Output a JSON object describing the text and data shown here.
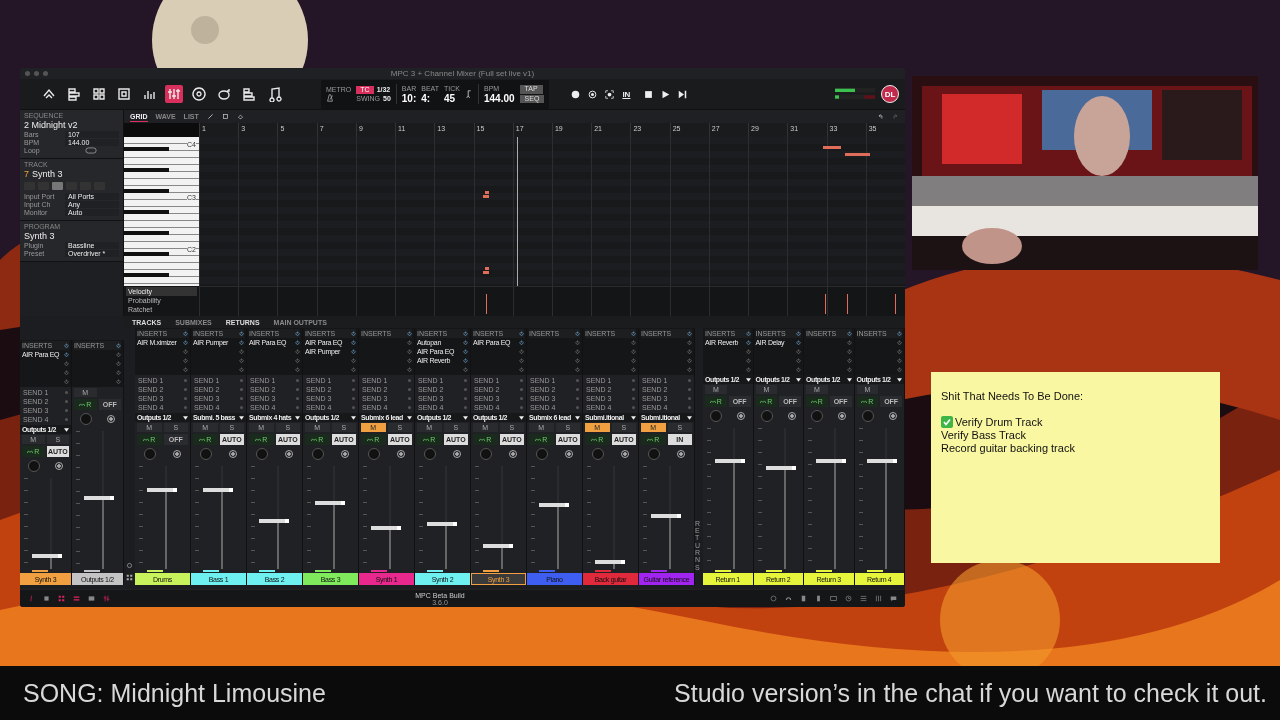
{
  "app": {
    "title": "MPC 3 + Channel Mixer (Full set live v1)",
    "view_buttons": [
      {
        "selected": false
      },
      {
        "selected": false
      },
      {
        "selected": false
      },
      {
        "selected": false
      },
      {
        "selected": false
      },
      {
        "selected": true
      },
      {
        "selected": false
      },
      {
        "selected": false
      },
      {
        "selected": false
      },
      {
        "selected": false
      }
    ],
    "transport": {
      "metro": "METRO",
      "tc": "TC",
      "tc_value": "1/32",
      "swing_label": "SWING",
      "swing": "50",
      "bar_label": "BAR",
      "bar": "10:",
      "beat_label": "BEAT",
      "beat": "4:",
      "tick_label": "TICK",
      "tick": "45",
      "bpm_label": "BPM",
      "bpm": "144.00",
      "tap": "TAP",
      "seq": "SEQ",
      "in": "IN",
      "user": "DL"
    },
    "sequence": {
      "header": "SEQUENCE",
      "name": "2 Midnight v2",
      "fields": [
        {
          "label": "Bars",
          "value": "107"
        },
        {
          "label": "BPM",
          "value": "144.00"
        }
      ],
      "loop": "Loop"
    },
    "track": {
      "header": "TRACK",
      "number": "7",
      "name": "Synth 3",
      "modes": [
        {
          "selected": false
        },
        {
          "selected": false
        },
        {
          "selected": true
        },
        {
          "selected": false
        },
        {
          "selected": false
        },
        {
          "selected": false
        }
      ],
      "fields": [
        {
          "label": "Input Port",
          "value": "All Ports"
        },
        {
          "label": "Input Ch",
          "value": "Any"
        },
        {
          "label": "Monitor",
          "value": "Auto"
        }
      ]
    },
    "program": {
      "header": "PROGRAM",
      "name": "Synth 3",
      "fields": [
        {
          "label": "Plugin",
          "value": "Bassline"
        },
        {
          "label": "Preset",
          "value": "Overdriver *"
        }
      ]
    },
    "editor_tabs": [
      {
        "label": "GRID",
        "selected": true
      },
      {
        "label": "WAVE",
        "selected": false
      },
      {
        "label": "LIST",
        "selected": false
      }
    ],
    "ruler": [
      "1",
      "3",
      "5",
      "7",
      "9",
      "11",
      "13",
      "15",
      "17",
      "19",
      "21",
      "23",
      "25",
      "27",
      "29",
      "31",
      "33",
      "35"
    ],
    "keys": [
      "C4",
      "C3",
      "C2"
    ],
    "lanes": [
      {
        "label": "Velocity",
        "selected": true
      },
      {
        "label": "Probability",
        "selected": false
      },
      {
        "label": "Ratchet",
        "selected": false
      }
    ],
    "mixer_tabs": [
      {
        "label": "TRACKS",
        "on": true
      },
      {
        "label": "SUBMIXES",
        "on": false
      },
      {
        "label": "RETURNS",
        "on": true
      },
      {
        "label": "MAIN OUTPUTS",
        "on": false
      }
    ],
    "returns_label": "RETURNS",
    "left_strips": [
      {
        "inserts_label": "INSERTS",
        "inserts": [
          "AIR Para EQ"
        ],
        "sends": [
          "SEND 1",
          "SEND 2",
          "SEND 3",
          "SEND 4"
        ],
        "output": "Outputs 1/2",
        "mute": "M",
        "muted": false,
        "solo": "S",
        "read": "R",
        "mode": "AUTO",
        "mode_on": true,
        "level": 0.12,
        "name": "Synth 3",
        "color": "#f0a040",
        "selected": false
      },
      {
        "inserts_label": "INSERTS",
        "mute": "M",
        "muted": false,
        "read": "R",
        "mode": "OFF",
        "mode_on": false,
        "level": 0.5,
        "name": "Outputs 1/2",
        "color": "#c4c4c4",
        "selected": false
      }
    ],
    "channels": [
      {
        "inserts_label": "INSERTS",
        "inserts": [
          "AIR M.ximizer"
        ],
        "sends": [
          "SEND 1",
          "SEND 2",
          "SEND 3",
          "SEND 4"
        ],
        "output": "Outputs 1/2",
        "mute": "M",
        "muted": false,
        "solo": "S",
        "read": "R",
        "mode": "OFF",
        "mode_on": false,
        "level": 0.75,
        "name": "Drums",
        "color": "#c8f25c",
        "selected": false
      },
      {
        "inserts_label": "INSERTS",
        "inserts": [
          "AIR Pumper"
        ],
        "sends": [
          "SEND 1",
          "SEND 2",
          "SEND 3",
          "SEND 4"
        ],
        "output": "Submi. 5 bass",
        "mute": "M",
        "muted": false,
        "solo": "S",
        "read": "R",
        "mode": "AUTO",
        "mode_on": true,
        "level": 0.75,
        "name": "Bass 1",
        "color": "#6ff0f0",
        "selected": false
      },
      {
        "inserts_label": "INSERTS",
        "inserts": [
          "AIR Para EQ"
        ],
        "sends": [
          "SEND 1",
          "SEND 2",
          "SEND 3",
          "SEND 4"
        ],
        "output": "Submix 4 hats",
        "mute": "M",
        "muted": false,
        "solo": "S",
        "read": "R",
        "mode": "AUTO",
        "mode_on": true,
        "level": 0.45,
        "name": "Bass 2",
        "color": "#6ff0f0",
        "selected": false
      },
      {
        "inserts_label": "INSERTS",
        "inserts": [
          "AIR Para EQ",
          "AIR Pumper"
        ],
        "sends": [
          "SEND 1",
          "SEND 2",
          "SEND 3",
          "SEND 4"
        ],
        "output": "Outputs 1/2",
        "mute": "M",
        "muted": false,
        "solo": "S",
        "read": "R",
        "mode": "AUTO",
        "mode_on": true,
        "level": 0.62,
        "name": "Bass 3",
        "color": "#7eea5c",
        "selected": false
      },
      {
        "inserts_label": "INSERTS",
        "sends": [
          "SEND 1",
          "SEND 2",
          "SEND 3",
          "SEND 4"
        ],
        "output": "Submix 6 lead",
        "mute": "M",
        "muted": true,
        "solo": "S",
        "read": "R",
        "mode": "AUTO",
        "mode_on": true,
        "level": 0.38,
        "name": "Synth 1",
        "color": "#e8288c",
        "selected": false
      },
      {
        "inserts_label": "INSERTS",
        "inserts": [
          "Autopan",
          "AIR Para EQ",
          "AIR Reverb"
        ],
        "sends": [
          "SEND 1",
          "SEND 2",
          "SEND 3",
          "SEND 4"
        ],
        "output": "Outputs 1/2",
        "mute": "M",
        "muted": false,
        "solo": "S",
        "read": "R",
        "mode": "AUTO",
        "mode_on": true,
        "level": 0.42,
        "name": "Synth 2",
        "color": "#6ff0f0",
        "selected": false
      },
      {
        "inserts_label": "INSERTS",
        "inserts": [
          "AIR Para EQ"
        ],
        "sends": [
          "SEND 1",
          "SEND 2",
          "SEND 3",
          "SEND 4"
        ],
        "output": "Outputs 1/2",
        "mute": "M",
        "muted": false,
        "solo": "S",
        "read": "R",
        "mode": "AUTO",
        "mode_on": true,
        "level": 0.2,
        "name": "Synth 3",
        "color": "#f0a040",
        "selected": true
      },
      {
        "inserts_label": "INSERTS",
        "sends": [
          "SEND 1",
          "SEND 2",
          "SEND 3",
          "SEND 4"
        ],
        "output": "Submix 6 lead",
        "mute": "M",
        "muted": false,
        "solo": "S",
        "read": "R",
        "mode": "AUTO",
        "mode_on": true,
        "level": 0.6,
        "name": "Piano",
        "color": "#3d5ef0",
        "selected": false
      },
      {
        "inserts_label": "INSERTS",
        "sends": [
          "SEND 1",
          "SEND 2",
          "SEND 3",
          "SEND 4"
        ],
        "output": "Submi.itional",
        "mute": "M",
        "muted": true,
        "solo": "S",
        "read": "R",
        "mode": "AUTO",
        "mode_on": true,
        "level": 0.05,
        "name": "Back guitar",
        "color": "#e02a3c",
        "selected": false
      },
      {
        "inserts_label": "INSERTS",
        "sends": [
          "SEND 1",
          "SEND 2",
          "SEND 3",
          "SEND 4"
        ],
        "output": "Submi.itional",
        "mute": "M",
        "muted": true,
        "solo": "S",
        "read": "R",
        "mode": "IN",
        "mode_on": true,
        "level": 0.5,
        "name": "Guitar reference",
        "color": "#a224f0",
        "selected": false
      }
    ],
    "returns": [
      {
        "inserts_label": "INSERTS",
        "inserts": [
          "AIR Reverb"
        ],
        "output": "Outputs 1/2",
        "mute": "M",
        "muted": false,
        "read": "R",
        "mode": "OFF",
        "mode_on": false,
        "level": 0.75,
        "name": "Return 1",
        "color": "#e6f53c",
        "selected": false
      },
      {
        "inserts_label": "INSERTS",
        "inserts": [
          "AIR Delay"
        ],
        "output": "Outputs 1/2",
        "mute": "M",
        "muted": false,
        "read": "R",
        "mode": "OFF",
        "mode_on": false,
        "level": 0.7,
        "name": "Return 2",
        "color": "#e6f53c",
        "selected": false
      },
      {
        "inserts_label": "INSERTS",
        "output": "Outputs 1/2",
        "mute": "M",
        "muted": false,
        "read": "R",
        "mode": "OFF",
        "mode_on": false,
        "level": 0.75,
        "name": "Return 3",
        "color": "#e6f53c",
        "selected": false
      },
      {
        "inserts_label": "INSERTS",
        "output": "Outputs 1/2",
        "mute": "M",
        "muted": false,
        "read": "R",
        "mode": "OFF",
        "mode_on": false,
        "level": 0.75,
        "name": "Return 4",
        "color": "#e6f53c",
        "selected": false
      }
    ],
    "footer": {
      "build": "MPC Beta Build",
      "version": "3.6.0"
    }
  },
  "note": {
    "title": "Shit That Needs To Be Done:",
    "items": [
      {
        "text": "Verify Drum Track",
        "done": true
      },
      {
        "text": "Verify Bass Track",
        "done": false
      },
      {
        "text": "Record guitar backing track",
        "done": false
      }
    ]
  },
  "banner": {
    "song": "SONG: Midnight Limousine",
    "message": "Studio version’s in the chat if you want to check it out."
  }
}
